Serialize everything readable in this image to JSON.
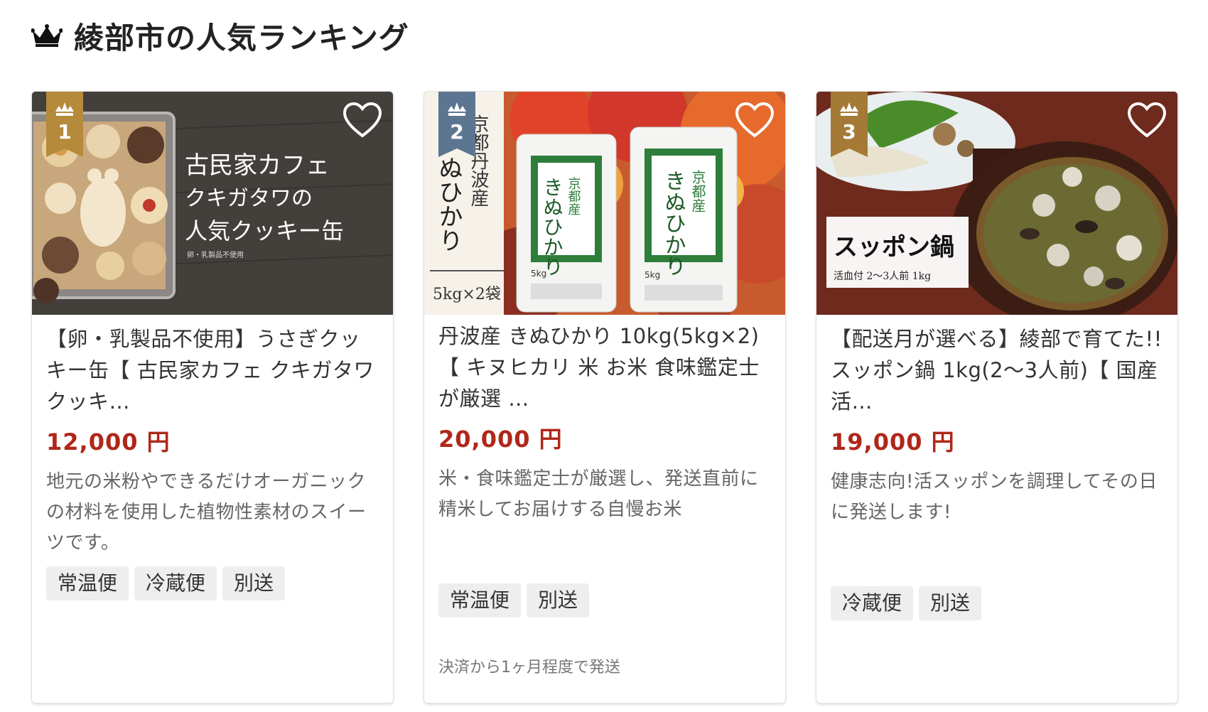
{
  "header": {
    "title": "綾部市の人気ランキング",
    "icon": "crown-icon"
  },
  "colors": {
    "price": "#b0271a",
    "badge_gold": "#b58a3a",
    "badge_blue": "#5c7591",
    "badge_bronze": "#a47a36"
  },
  "cards": [
    {
      "rank": "1",
      "image_text": {
        "line1": "古民家カフェ",
        "line2": "クキガタワの",
        "line3": "人気クッキー缶",
        "small": "卵・乳製品不使用"
      },
      "title": "【卵・乳製品不使用】うさぎクッキー缶【 古民家カフェ クキガタワ クッキ…",
      "price": "12,000 円",
      "description": "地元の米粉やできるだけオーガニックの材料を使用した植物性素材のスイーツです。",
      "tags": [
        "常温便",
        "冷蔵便",
        "別送"
      ],
      "note": ""
    },
    {
      "rank": "2",
      "image_text": {
        "vertical1": "京都丹波産",
        "vertical2": "ぬひかり",
        "weight": "5kg×2袋",
        "bag_label": "京都産",
        "bag_name": "きぬひかり",
        "bag_weight": "5kg"
      },
      "title": "丹波産 きぬひかり 10kg(5kg×2)【 キヌヒカリ 米 お米 食味鑑定士 が厳選 …",
      "price": "20,000 円",
      "description": "米・食味鑑定士が厳選し、発送直前に精米してお届けする自慢お米",
      "tags": [
        "常温便",
        "別送"
      ],
      "note": "決済から1ヶ月程度で発送"
    },
    {
      "rank": "3",
      "image_text": {
        "name": "スッポン鍋",
        "sub": "活血付 2〜3人前 1kg"
      },
      "title": "【配送月が選べる】綾部で育てた!!スッポン鍋 1kg(2〜3人前)【 国産 活…",
      "price": "19,000 円",
      "description": "健康志向!活スッポンを調理してその日に発送します!",
      "tags": [
        "冷蔵便",
        "別送"
      ],
      "note": ""
    }
  ]
}
